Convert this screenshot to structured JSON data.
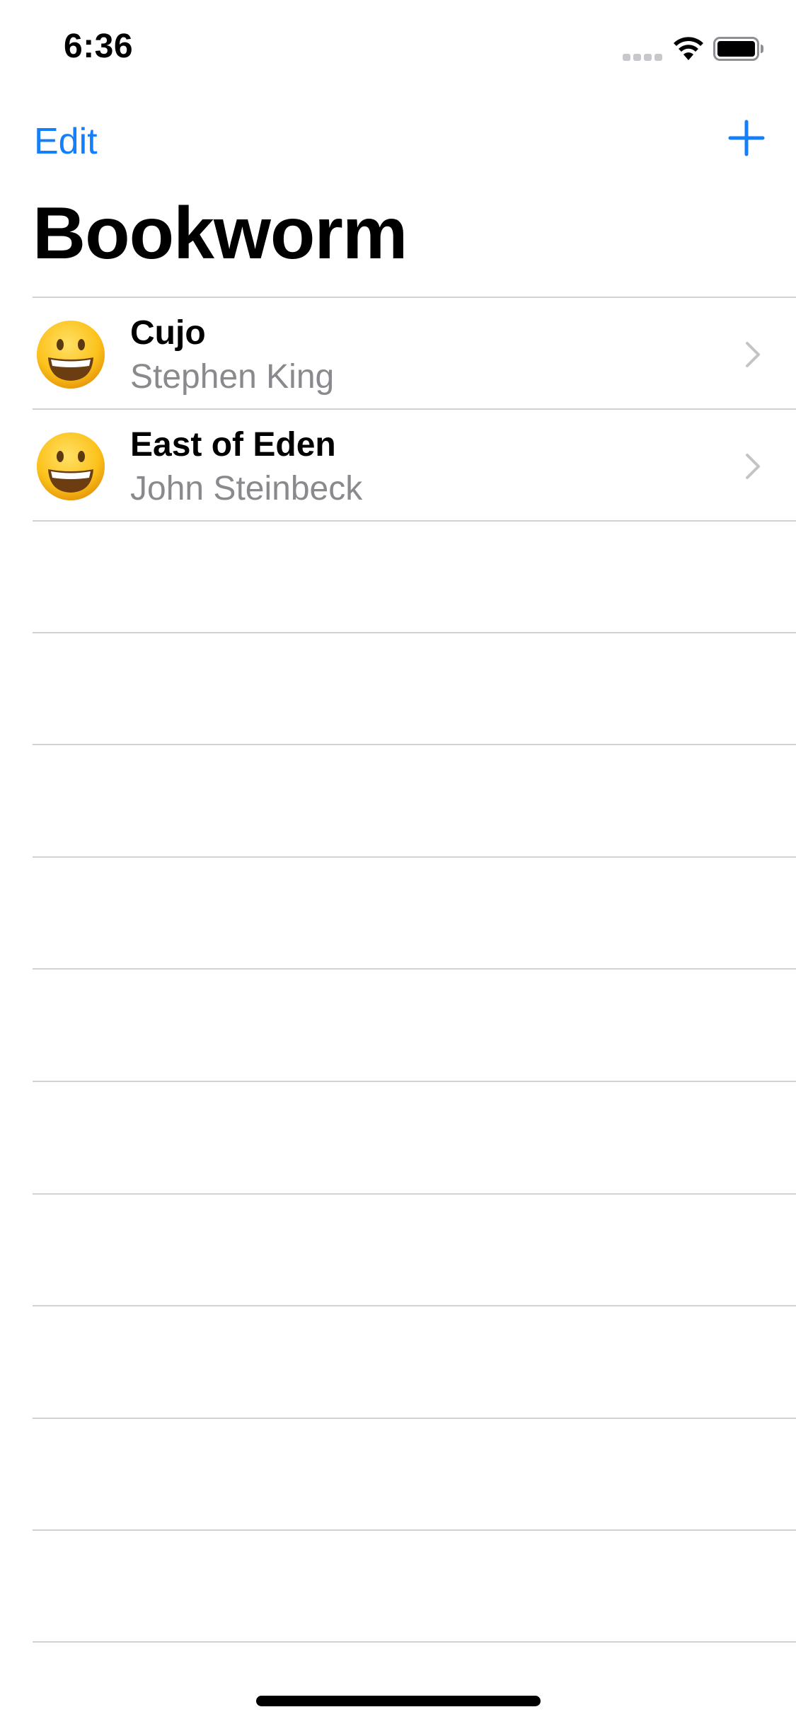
{
  "status_bar": {
    "time": "6:36",
    "icons": [
      "cellular-signal-icon",
      "wifi-icon",
      "battery-icon"
    ]
  },
  "nav": {
    "edit_label": "Edit",
    "add_icon": "plus-icon",
    "title": "Bookworm"
  },
  "books": [
    {
      "title": "Cujo",
      "author": "Stephen King",
      "rating_emoji": "grinning-face-icon"
    },
    {
      "title": "East of Eden",
      "author": "John Steinbeck",
      "rating_emoji": "grinning-face-icon"
    }
  ],
  "colors": {
    "accent": "#147efb",
    "secondary_text": "#8a8a8e",
    "separator": "#d1d1d6",
    "chevron": "#c4c4c7"
  }
}
